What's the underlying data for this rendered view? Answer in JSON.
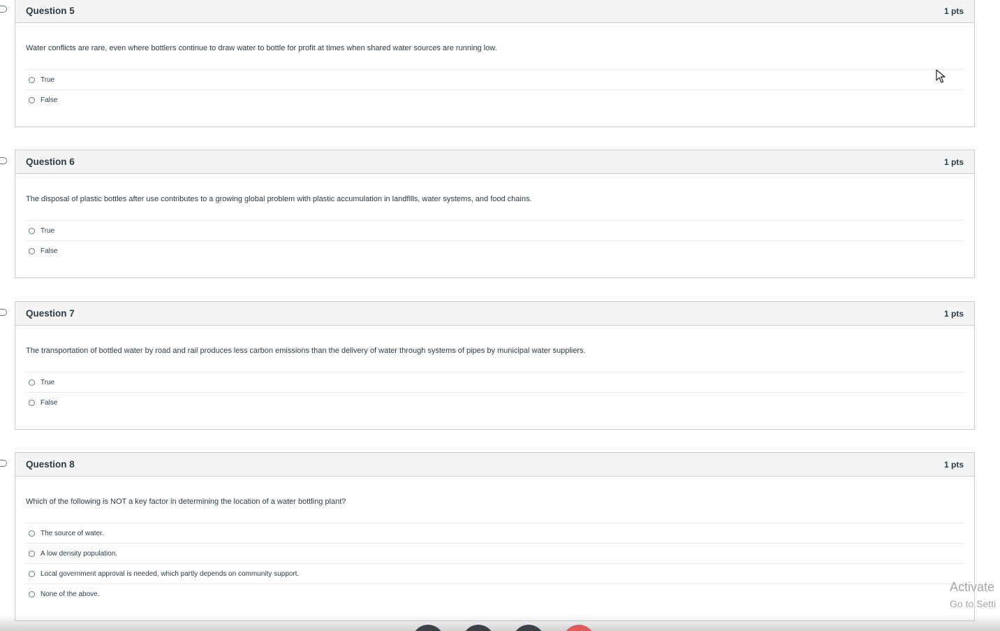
{
  "questions": [
    {
      "title": "Question 5",
      "points": "1 pts",
      "text": "Water conflicts are rare, even where bottlers continue to draw water to bottle for profit at times when shared water sources are running low.",
      "answers": [
        "True",
        "False"
      ]
    },
    {
      "title": "Question 6",
      "points": "1 pts",
      "text": "The disposal of plastic bottles after use contributes to a growing global problem with plastic accumulation in landfills, water systems, and food chains.",
      "answers": [
        "True",
        "False"
      ]
    },
    {
      "title": "Question 7",
      "points": "1 pts",
      "text": "The transportation of bottled water by road and rail produces less carbon emissions than the delivery of water through systems of pipes by municipal water suppliers.",
      "answers": [
        "True",
        "False"
      ]
    },
    {
      "title": "Question 8",
      "points": "1 pts",
      "text": "Which of the following is NOT a key factor in determining the location of a water bottling plant?",
      "answers": [
        "The source of water.",
        "A low density population.",
        "Local government approval is needed, which partly depends on community support.",
        "None of the above."
      ]
    }
  ],
  "watermark": {
    "line1": "Activate",
    "line2": "Go to Setti"
  },
  "icons": {
    "flag": "flag-question-icon",
    "cursor": "mouse-pointer-icon",
    "radio": "radio-button-icon"
  }
}
